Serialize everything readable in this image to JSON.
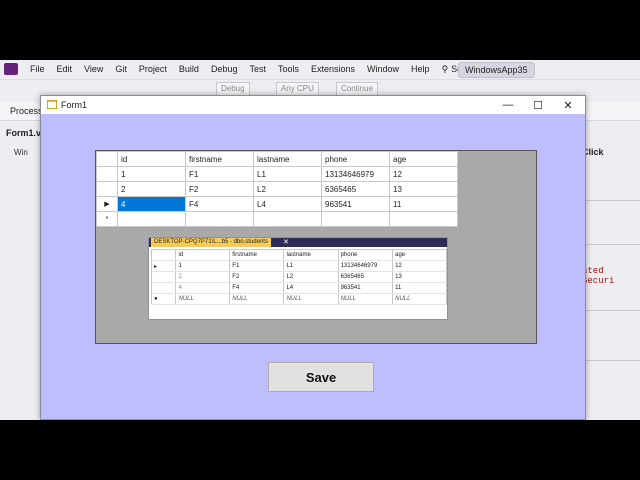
{
  "vs": {
    "menu": [
      "File",
      "Edit",
      "View",
      "Git",
      "Project",
      "Build",
      "Debug",
      "Test",
      "Tools",
      "Extensions",
      "Window",
      "Help"
    ],
    "search_label": "Search",
    "solution_title": "WindowsApp35",
    "toolbar": {
      "config": "Debug",
      "platform": "Any CPU",
      "continue_label": "Continue"
    },
    "process_label": "Process:",
    "file_tab": "Form1.v",
    "tree_item": "Win",
    "right_label": "Click",
    "right_code": "ated Securi"
  },
  "form": {
    "title": "Form1",
    "save_label": "Save",
    "grid": {
      "columns": [
        "id",
        "firstname",
        "lastname",
        "phone",
        "age"
      ],
      "rows": [
        [
          "1",
          "F1",
          "L1",
          "13134646979",
          "12"
        ],
        [
          "2",
          "F2",
          "L2",
          "6365465",
          "13"
        ],
        [
          "4",
          "F4",
          "L4",
          "963541",
          "11"
        ]
      ],
      "new_row_marker": "*",
      "current_row_marker": "▶"
    }
  },
  "ssms": {
    "tab_title": "DESKTOP-CPQ7P71\\L...b5 - dbo.students",
    "columns": [
      "id",
      "firstname",
      "lastname",
      "phone",
      "age"
    ],
    "rows": [
      [
        "1",
        "F1",
        "L1",
        "13134646979",
        "12"
      ],
      [
        "2",
        "F2",
        "L2",
        "6365465",
        "13"
      ],
      [
        "4",
        "F4",
        "L4",
        "963541",
        "11"
      ],
      [
        "NULL",
        "NULL",
        "NULL",
        "NULL",
        "NULL"
      ]
    ]
  }
}
